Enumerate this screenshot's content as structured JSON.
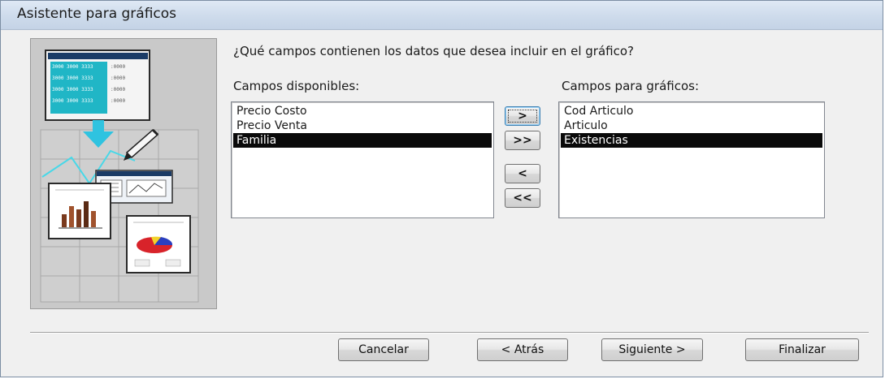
{
  "window": {
    "title": "Asistente para gráficos"
  },
  "question": "¿Qué campos contienen los datos que desea incluir en el gráfico?",
  "available": {
    "label": "Campos disponibles:",
    "items": [
      {
        "text": "Precio Costo",
        "selected": false
      },
      {
        "text": "Precio Venta",
        "selected": false
      },
      {
        "text": "Familia",
        "selected": true
      }
    ]
  },
  "chart_fields": {
    "label": "Campos para gráficos:",
    "items": [
      {
        "text": "Cod Articulo",
        "selected": false
      },
      {
        "text": "Articulo",
        "selected": false
      },
      {
        "text": "Existencias",
        "selected": true
      }
    ]
  },
  "move_buttons": {
    "add_one": ">",
    "add_all": ">>",
    "remove_one": "<",
    "remove_all": "<<"
  },
  "footer": {
    "cancel": "Cancelar",
    "back": "< Atrás",
    "next": "Siguiente >",
    "finish": "Finalizar"
  },
  "illustration": {
    "grid_cell_text": [
      "3000 3000 3333",
      ":0000"
    ],
    "colors": {
      "panel": "#c9c9c9",
      "table_fill": "#1fb7c8",
      "arrow": "#2fc3e0",
      "bar_brown": "#7a3a1e",
      "pie_red": "#d8232a",
      "pie_blue": "#2a3fbf",
      "pie_yellow": "#f2d22a"
    }
  }
}
